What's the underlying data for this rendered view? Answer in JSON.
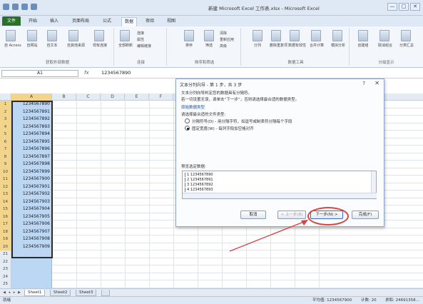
{
  "titlebar": {
    "title": "新建 Microsoft Excel 工作表.xlsx - Microsoft Excel",
    "controls": [
      "—",
      "□",
      "✕"
    ]
  },
  "tabs": {
    "file": "文件",
    "items": [
      {
        "label": "开始"
      },
      {
        "label": "插入"
      },
      {
        "label": "页面布局"
      },
      {
        "label": "公式"
      },
      {
        "label": "数据"
      },
      {
        "label": "审阅"
      },
      {
        "label": "视图"
      }
    ],
    "active": "数据"
  },
  "ribbon": {
    "groups": [
      {
        "label": "获取外部数据",
        "buttons": [
          "自 Access",
          "自网站",
          "自文本",
          "自其他来源",
          "现有连接"
        ]
      },
      {
        "label": "连接",
        "buttons": [
          "全部刷新",
          "连接",
          "属性",
          "编辑链接"
        ]
      },
      {
        "label": "排序和筛选",
        "buttons": [
          "排序",
          "筛选",
          "清除",
          "重新应用",
          "高级"
        ]
      },
      {
        "label": "数据工具",
        "buttons": [
          "分列",
          "删除重复项",
          "数据有效性",
          "合并计算",
          "模拟分析"
        ]
      },
      {
        "label": "分级显示",
        "buttons": [
          "创建组",
          "取消组合",
          "分类汇总"
        ]
      }
    ]
  },
  "formula_bar": {
    "name_box": "A1",
    "fx": "fx",
    "value": "1234567890"
  },
  "grid": {
    "columns": [
      "A",
      "B",
      "C",
      "D",
      "E",
      "F",
      "G",
      "H",
      "I",
      "J",
      "K",
      "L"
    ],
    "rows": [
      {
        "num": "1",
        "a": "1234567890"
      },
      {
        "num": "2",
        "a": "1234567891"
      },
      {
        "num": "3",
        "a": "1234567892"
      },
      {
        "num": "4",
        "a": "1234567893"
      },
      {
        "num": "5",
        "a": "1234567894"
      },
      {
        "num": "6",
        "a": "1234567895"
      },
      {
        "num": "7",
        "a": "1234567896"
      },
      {
        "num": "8",
        "a": "1234567897"
      },
      {
        "num": "9",
        "a": "1234567898"
      },
      {
        "num": "10",
        "a": "1234567899"
      },
      {
        "num": "11",
        "a": "1234567900"
      },
      {
        "num": "12",
        "a": "1234567901"
      },
      {
        "num": "13",
        "a": "1234567902"
      },
      {
        "num": "14",
        "a": "1234567903"
      },
      {
        "num": "15",
        "a": "1234567904"
      },
      {
        "num": "16",
        "a": "1234567905"
      },
      {
        "num": "17",
        "a": "1234567906"
      },
      {
        "num": "18",
        "a": "1234567907"
      },
      {
        "num": "19",
        "a": "1234567908"
      },
      {
        "num": "20",
        "a": "1234567909"
      },
      {
        "num": "21",
        "a": ""
      },
      {
        "num": "22",
        "a": ""
      },
      {
        "num": "23",
        "a": ""
      },
      {
        "num": "24",
        "a": ""
      },
      {
        "num": "25",
        "a": ""
      }
    ]
  },
  "sheets": {
    "tabs": [
      "Sheet1",
      "Sheet2",
      "Sheet3"
    ],
    "active": "Sheet1"
  },
  "status": {
    "ready": "就绪",
    "average": "平均值: 1234567900",
    "count": "计数: 20",
    "sum": "求和: 24691358..."
  },
  "dialog": {
    "title": "文本分列向导 - 第 1 步，共 3 步",
    "help": "?",
    "close": "✕",
    "line1": "文本分列向导判定您的数据具有分隔符。",
    "line2": "若一切设置无误，请单击“下一步”，否则请选择最合适的数据类型。",
    "section_original": "原始数据类型",
    "choose_label": "请选择最合适的文件类型:",
    "option_delimited": "分隔符号(D) - 用分隔字符，如逗号或制表符分隔每个字段",
    "option_fixed": "固定宽度(W) - 每列字段加空格对齐",
    "preview_label": "预览选定数据:",
    "preview_lines": [
      "1 1234567890",
      "2 1234567891",
      "3 1234567892",
      "4 1234567893"
    ],
    "buttons": {
      "cancel": "取消",
      "back": "< 上一步(B)",
      "next": "下一步(N) >",
      "finish": "完成(F)"
    }
  },
  "colors": {
    "selection": "#bcd7f3",
    "annotation": "#d94242",
    "file_tab": "#2a6f2a"
  }
}
